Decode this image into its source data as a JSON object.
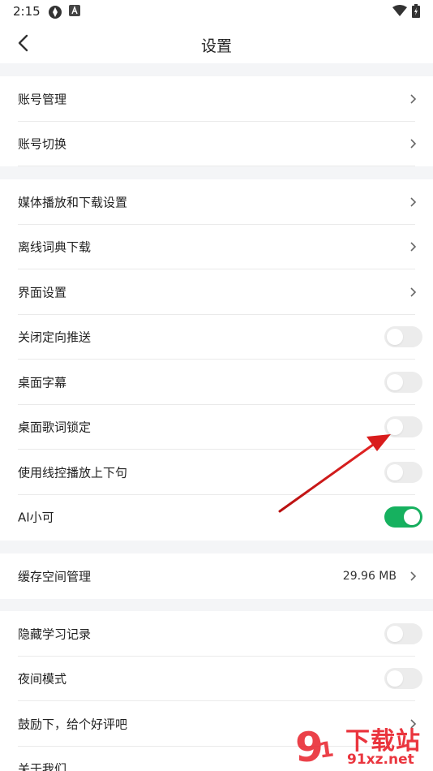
{
  "status": {
    "time": "2:15"
  },
  "header": {
    "title": "设置"
  },
  "groups": {
    "account": [
      {
        "label": "账号管理"
      },
      {
        "label": "账号切换"
      }
    ],
    "main": [
      {
        "label": "媒体播放和下载设置"
      },
      {
        "label": "离线词典下载"
      },
      {
        "label": "界面设置"
      },
      {
        "label": "关闭定向推送",
        "toggle": false
      },
      {
        "label": "桌面字幕",
        "toggle": false
      },
      {
        "label": "桌面歌词锁定",
        "toggle": false
      },
      {
        "label": "使用线控播放上下句",
        "toggle": false
      },
      {
        "label": "AI小可",
        "toggle": true
      }
    ],
    "cache": [
      {
        "label": "缓存空间管理",
        "value": "29.96 MB"
      }
    ],
    "other": [
      {
        "label": "隐藏学习记录",
        "toggle": false
      },
      {
        "label": "夜间模式",
        "toggle": false
      },
      {
        "label": "鼓励下，给个好评吧"
      },
      {
        "label": "关于我们"
      }
    ]
  },
  "watermark": {
    "text": "下载站",
    "url": "91xz.net"
  },
  "colors": {
    "accent": "#16b15f",
    "annotation_arrow": "#d91c1c",
    "watermark": "#e8202a"
  }
}
